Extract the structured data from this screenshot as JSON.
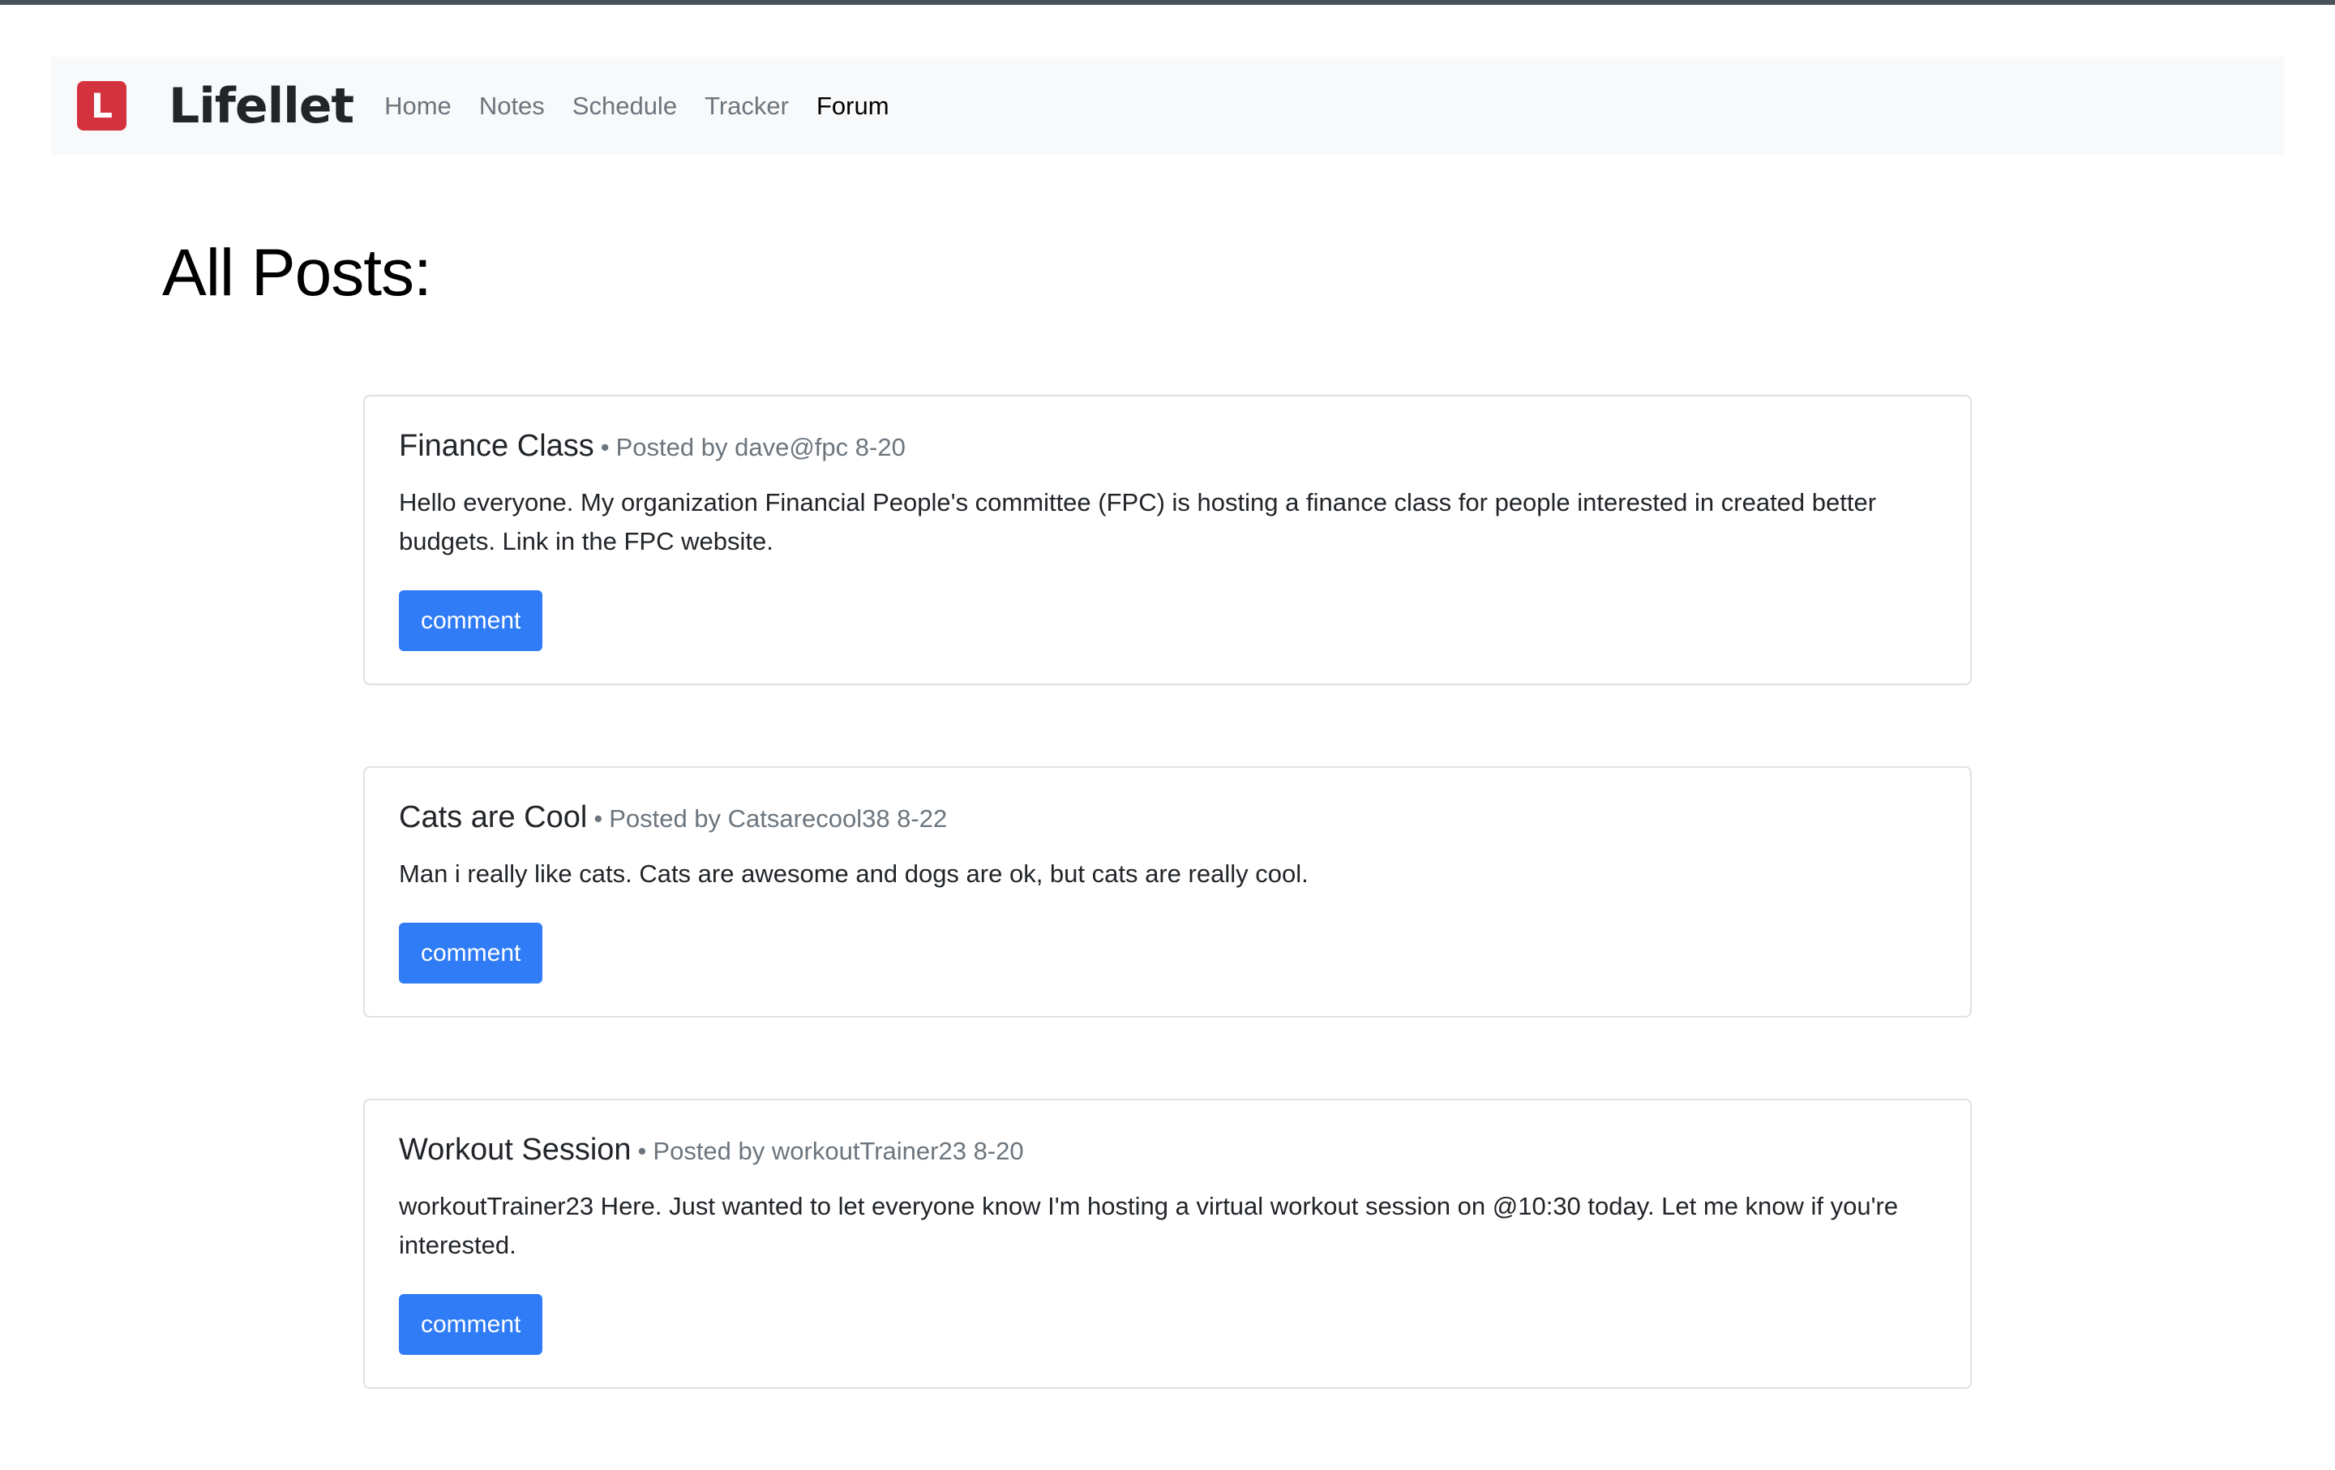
{
  "brand": {
    "logo_letter": "L",
    "name": "Lifellet",
    "logo_color": "#d5323f"
  },
  "nav": {
    "items": [
      {
        "label": "Home",
        "active": false
      },
      {
        "label": "Notes",
        "active": false
      },
      {
        "label": "Schedule",
        "active": false
      },
      {
        "label": "Tracker",
        "active": false
      },
      {
        "label": "Forum",
        "active": true
      }
    ]
  },
  "page": {
    "title": "All Posts:"
  },
  "posts": [
    {
      "title": "Finance Class",
      "separator": "•",
      "meta": "Posted by dave@fpc 8-20",
      "body": "Hello everyone. My organization Financial People's committee (FPC) is hosting a finance class for people interested in created better budgets. Link in the FPC website.",
      "button_label": "comment"
    },
    {
      "title": "Cats are Cool",
      "separator": "•",
      "meta": "Posted by Catsarecool38 8-22",
      "body": "Man i really like cats. Cats are awesome and dogs are ok, but cats are really cool.",
      "button_label": "comment"
    },
    {
      "title": "Workout Session",
      "separator": "•",
      "meta": "Posted by workoutTrainer23 8-20",
      "body": "workoutTrainer23 Here. Just wanted to let everyone know I'm hosting a virtual workout session on @10:30 today. Let me know if you're interested.",
      "button_label": "comment"
    }
  ],
  "colors": {
    "accent": "#2f7cf6",
    "navbar_bg": "#f8f9fa",
    "muted_text": "#6c757d"
  }
}
